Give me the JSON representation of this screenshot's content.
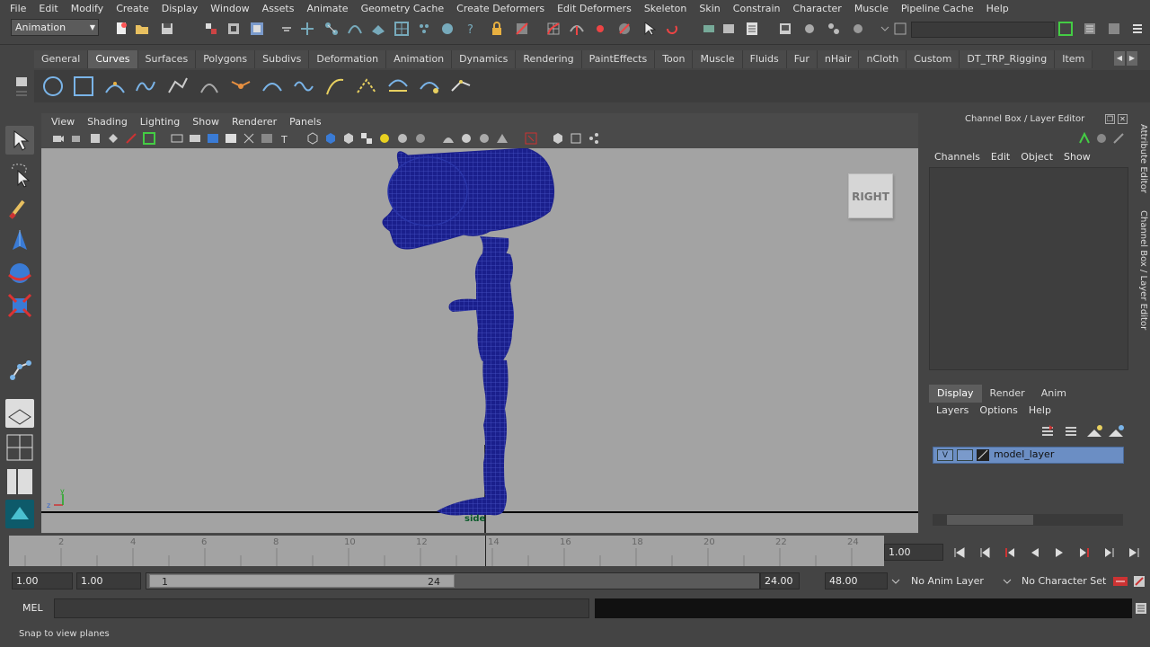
{
  "menubar": [
    "File",
    "Edit",
    "Modify",
    "Create",
    "Display",
    "Window",
    "Assets",
    "Animate",
    "Geometry Cache",
    "Create Deformers",
    "Edit Deformers",
    "Skeleton",
    "Skin",
    "Constrain",
    "Character",
    "Muscle",
    "Pipeline Cache",
    "Help"
  ],
  "status": {
    "mode": "Animation"
  },
  "shelf": {
    "tabs": [
      "General",
      "Curves",
      "Surfaces",
      "Polygons",
      "Subdivs",
      "Deformation",
      "Animation",
      "Dynamics",
      "Rendering",
      "PaintEffects",
      "Toon",
      "Muscle",
      "Fluids",
      "Fur",
      "nHair",
      "nCloth",
      "Custom",
      "DT_TRP_Rigging",
      "Item"
    ],
    "active_tab": "Curves"
  },
  "viewport": {
    "menu": [
      "View",
      "Shading",
      "Lighting",
      "Show",
      "Renderer",
      "Panels"
    ],
    "view_cube": "RIGHT",
    "camera_label": "side",
    "mesh_color": "#1a1f8c",
    "background": "#a3a3a3"
  },
  "channel_box": {
    "title": "Channel Box / Layer Editor",
    "menu": [
      "Channels",
      "Edit",
      "Object",
      "Show"
    ]
  },
  "layer_editor": {
    "tabs": [
      "Display",
      "Render",
      "Anim"
    ],
    "active_tab": "Display",
    "menu": [
      "Layers",
      "Options",
      "Help"
    ],
    "layer": {
      "visibility": "V",
      "name": "model_layer"
    }
  },
  "side_tabs": [
    "Attribute Editor",
    "Channel Box / Layer Editor"
  ],
  "timeslider": {
    "ticks": [
      "2",
      "4",
      "6",
      "8",
      "10",
      "12",
      "14",
      "16",
      "18",
      "20",
      "22",
      "24"
    ],
    "current_time": "1.00"
  },
  "range": {
    "start_time": "1.00",
    "playback_start": "1.00",
    "range_lo": "1",
    "range_hi": "24",
    "playback_end": "24.00",
    "end_time": "48.00",
    "anim_layer": "No Anim Layer",
    "character_set": "No Character Set"
  },
  "command_line": {
    "label": "MEL"
  },
  "help_line": "Snap to view planes"
}
